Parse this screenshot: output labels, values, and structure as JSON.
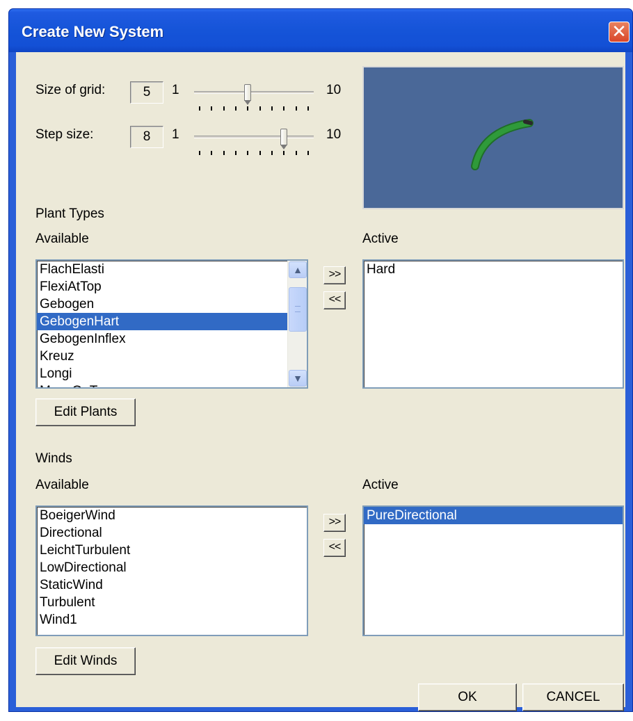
{
  "window": {
    "title": "Create New System",
    "close_glyph": "✕"
  },
  "grid": {
    "label": "Size of grid:",
    "value": "5",
    "min": "1",
    "max": "10",
    "level": 5
  },
  "step": {
    "label": "Step size:",
    "value": "8",
    "min": "1",
    "max": "10",
    "level": 8
  },
  "plants": {
    "section_label": "Plant Types",
    "available_label": "Available",
    "active_label": "Active",
    "available_items": [
      "FlachElasti",
      "FlexiAtTop",
      "Gebogen",
      "GebogenHart",
      "GebogenInflex",
      "Kreuz",
      "Longi",
      "MoveOnTop"
    ],
    "selected_item": "GebogenHart",
    "active_items": [
      "Hard"
    ],
    "add_label": ">>",
    "remove_label": "<<",
    "edit_label": "Edit Plants"
  },
  "winds": {
    "section_label": "Winds",
    "available_label": "Available",
    "active_label": "Active",
    "available_items": [
      "BoeigerWind",
      "Directional",
      "LeichtTurbulent",
      "LowDirectional",
      "StaticWind",
      "Turbulent",
      "Wind1"
    ],
    "active_items": [
      "PureDirectional"
    ],
    "selected_active_item": "PureDirectional",
    "add_label": ">>",
    "remove_label": "<<",
    "edit_label": "Edit Winds"
  },
  "buttons": {
    "ok": "OK",
    "cancel": "CANCEL"
  },
  "colors": {
    "title_bar": "#1554d8",
    "preview_bg": "#4a6898",
    "selection": "#316ac5",
    "plant_stem": "#2f9a3a"
  },
  "icons": {
    "close": "close-icon",
    "scroll_up": "scroll-up-icon",
    "scroll_down": "scroll-down-icon"
  }
}
